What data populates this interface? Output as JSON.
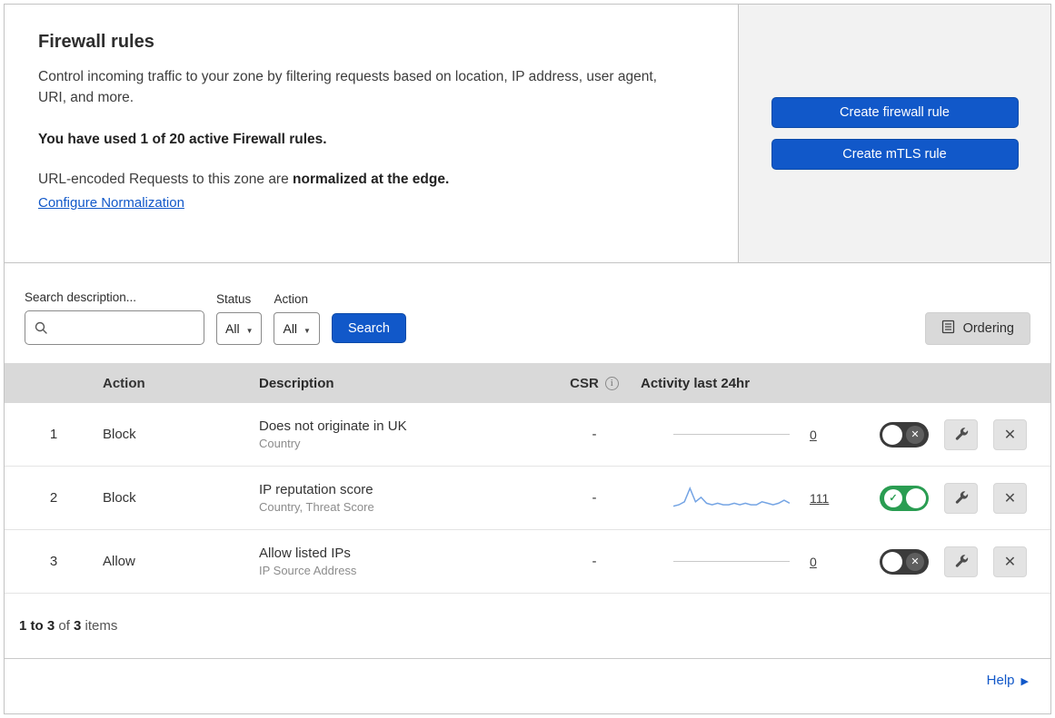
{
  "colors": {
    "accent": "#1158c9",
    "toggle-on": "#2a9d52",
    "toggle-off": "#3b3b3b",
    "sparkline": "#74a4e4",
    "link": "#1158c9"
  },
  "header": {
    "title": "Firewall rules",
    "description": "Control incoming traffic to your zone by filtering requests based on location, IP address, user agent, URI, and more.",
    "usage": "You have used 1 of 20 active Firewall rules.",
    "normalization_prefix": "URL-encoded Requests to this zone are ",
    "normalization_bold": "normalized at the edge.",
    "normalization_link": "Configure Normalization",
    "buttons": [
      {
        "label": "Create firewall rule"
      },
      {
        "label": "Create mTLS rule"
      }
    ]
  },
  "filters": {
    "search_label": "Search description...",
    "search_value": "",
    "status_label": "Status",
    "status_value": "All",
    "action_label": "Action",
    "action_value": "All",
    "search_button": "Search",
    "ordering_button": "Ordering"
  },
  "table": {
    "columns": {
      "action": "Action",
      "description": "Description",
      "csr": "CSR",
      "activity": "Activity last 24hr"
    },
    "rows": [
      {
        "index": "1",
        "action": "Block",
        "description": "Does not originate in UK",
        "criteria": "Country",
        "csr": "-",
        "activity": "0",
        "enabled": false,
        "sparkline": []
      },
      {
        "index": "2",
        "action": "Block",
        "description": "IP reputation score",
        "criteria": "Country, Threat Score",
        "csr": "-",
        "activity": "111",
        "enabled": true,
        "sparkline": [
          2,
          3,
          5,
          14,
          5,
          8,
          4,
          3,
          4,
          3,
          3,
          4,
          3,
          4,
          3,
          3,
          5,
          4,
          3,
          4,
          6,
          4
        ]
      },
      {
        "index": "3",
        "action": "Allow",
        "description": "Allow listed IPs",
        "criteria": "IP Source Address",
        "csr": "-",
        "activity": "0",
        "enabled": false,
        "sparkline": []
      }
    ]
  },
  "footer": {
    "range": "1 to 3",
    "of": " of ",
    "total": "3",
    "items": " items",
    "help": "Help"
  }
}
